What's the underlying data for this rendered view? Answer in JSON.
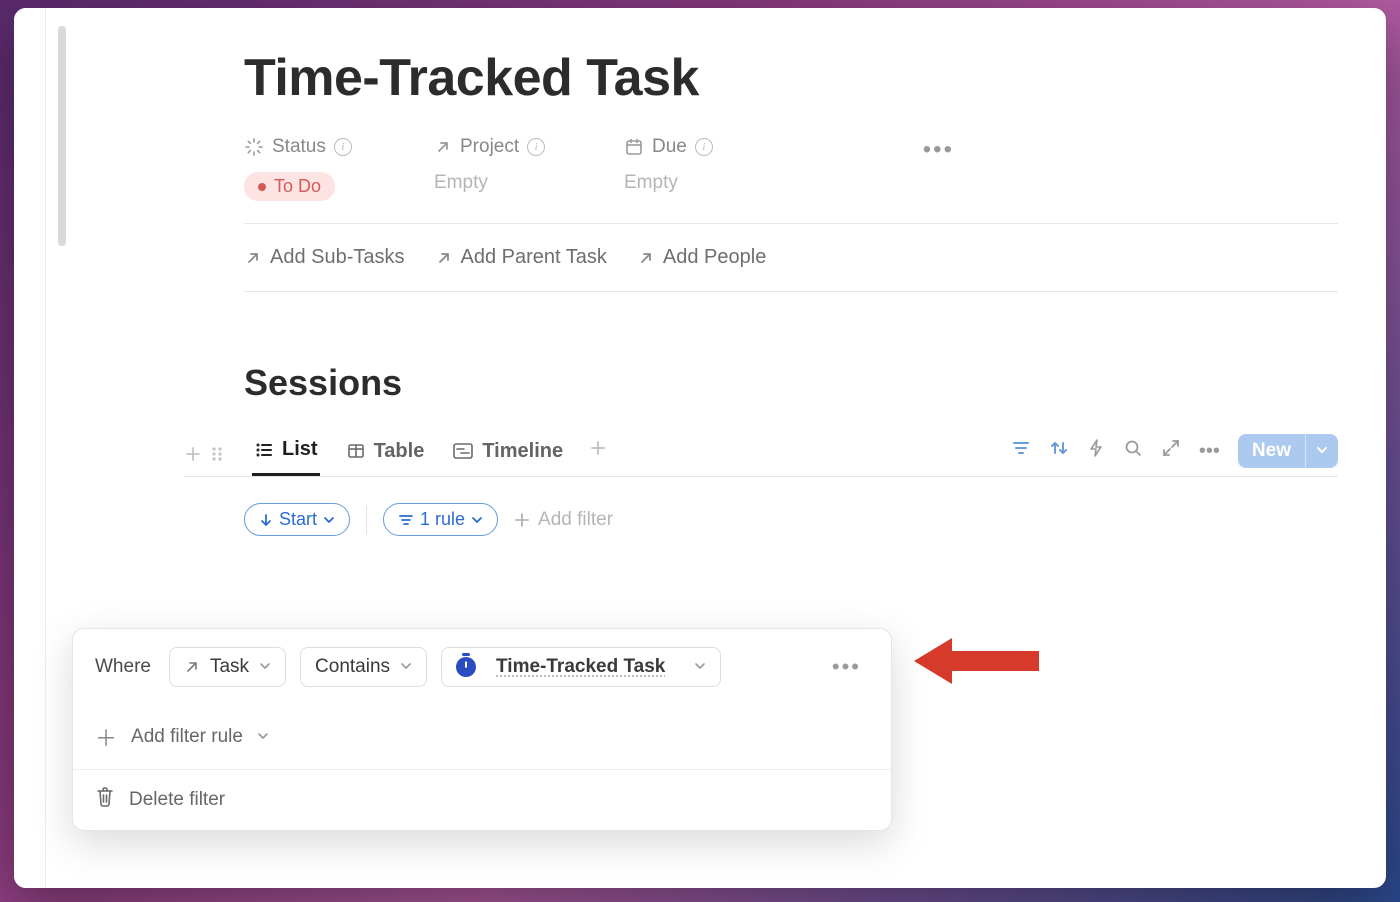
{
  "page": {
    "title": "Time-Tracked Task"
  },
  "properties": {
    "status": {
      "label": "Status",
      "value": "To Do"
    },
    "project": {
      "label": "Project",
      "value": "Empty"
    },
    "due": {
      "label": "Due",
      "value": "Empty"
    }
  },
  "add_relations": {
    "sub_tasks": "Add Sub-Tasks",
    "parent_task": "Add Parent Task",
    "people": "Add People"
  },
  "section": {
    "title": "Sessions"
  },
  "tabs": {
    "list": "List",
    "table": "Table",
    "timeline": "Timeline"
  },
  "toolbar": {
    "new_label": "New"
  },
  "filters": {
    "sort_label": "Start",
    "rule_count_label": "1 rule",
    "add_filter_label": "Add filter"
  },
  "filter_popup": {
    "where": "Where",
    "property": "Task",
    "condition": "Contains",
    "value": "Time-Tracked Task",
    "add_rule": "Add filter rule",
    "delete": "Delete filter"
  }
}
